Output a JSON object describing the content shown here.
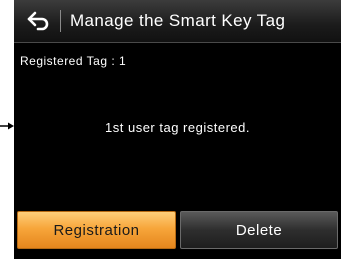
{
  "header": {
    "title": "Manage the Smart Key Tag",
    "back_icon": "back-arrow-icon"
  },
  "status": {
    "registered_label": "Registered Tag : 1"
  },
  "main": {
    "message": "1st user tag registered."
  },
  "buttons": {
    "registration_label": "Registration",
    "delete_label": "Delete"
  },
  "colors": {
    "screen_background": "#000000",
    "registration_button": "#f7a63b",
    "delete_button": "#2e2e2e",
    "text": "#ffffff"
  },
  "callout": {
    "pointer_icon": "arrow-pointer-icon"
  }
}
